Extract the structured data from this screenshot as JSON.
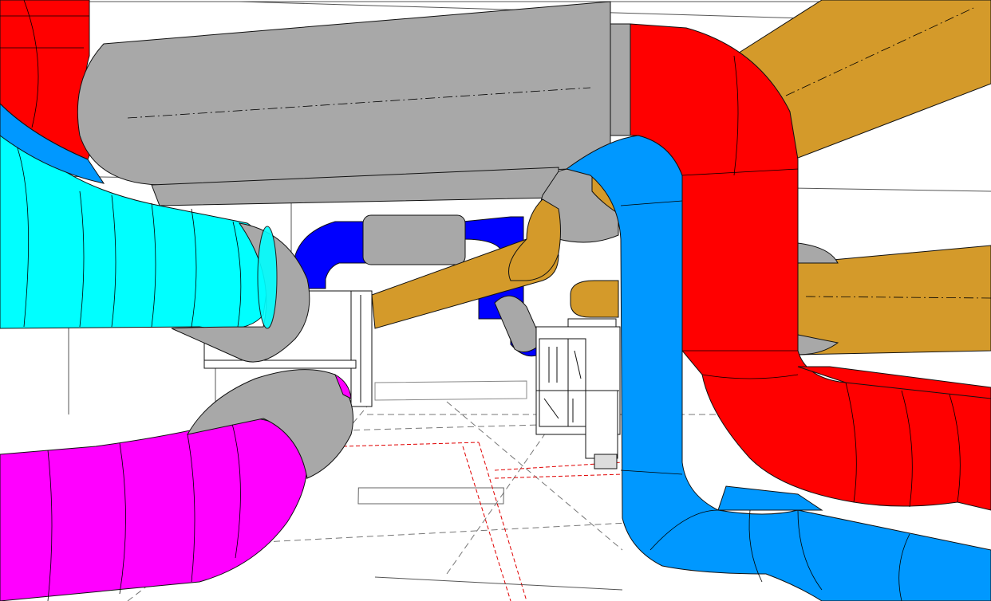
{
  "viewport": {
    "content": "3d-duct-model-view"
  },
  "colors": {
    "background": "#ffffff",
    "gray_duct": "#a8a8a8",
    "gray_duct_shadow": "#8e8e8e",
    "red_duct": "#ff0000",
    "cyan_duct": "#00ffff",
    "magenta_duct": "#ff00ff",
    "light_blue_duct": "#0098ff",
    "dark_blue_duct": "#0000ff",
    "orange_duct": "#d49a2a",
    "unit_fill": "#ffffff",
    "outline": "#111111",
    "floor_line": "#666666",
    "floor_red_line": "#e00000"
  },
  "icons": {
    "air_handler_left": "air-handling-unit",
    "air_handler_right": "air-handling-unit"
  }
}
